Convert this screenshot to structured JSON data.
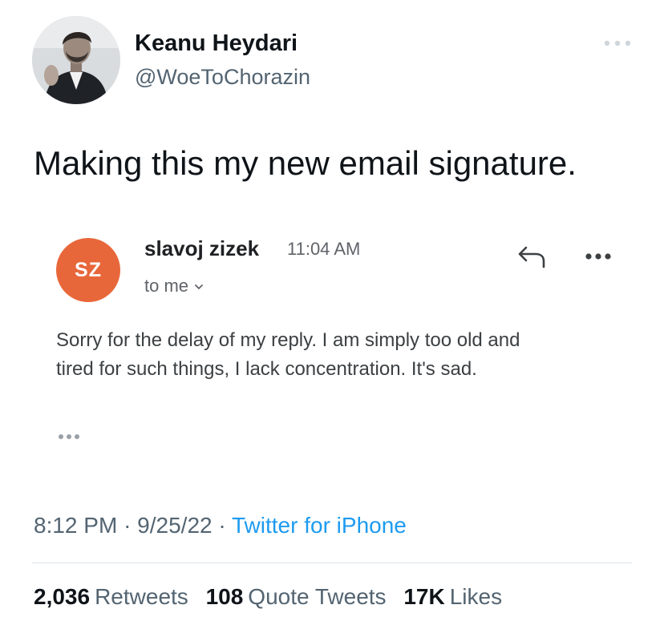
{
  "tweet": {
    "author": {
      "name": "Keanu Heydari",
      "handle": "@WoeToChorazin"
    },
    "text": "Making this my new email signature.",
    "more_icon": "more-horizontal-icon",
    "meta": {
      "time": "8:12 PM",
      "date": "9/25/22",
      "separator": "·",
      "source": "Twitter for iPhone"
    },
    "stats": [
      {
        "count": "2,036",
        "label": "Retweets"
      },
      {
        "count": "108",
        "label": "Quote Tweets"
      },
      {
        "count": "17K",
        "label": "Likes"
      }
    ],
    "colors": {
      "link": "#1d9bf0",
      "secondary": "#536471"
    }
  },
  "email": {
    "avatar_initials": "SZ",
    "avatar_color": "#e8673a",
    "sender": "slavoj zizek",
    "time": "11:04 AM",
    "recipient": "to me",
    "body_lines": [
      "Sorry for the delay of my reply. I am simply too old and",
      "tired for such things, I lack concentration. It's sad."
    ],
    "icons": [
      "reply-icon",
      "more-horizontal-icon",
      "chevron-down-icon",
      "trimmed-content-icon"
    ]
  }
}
